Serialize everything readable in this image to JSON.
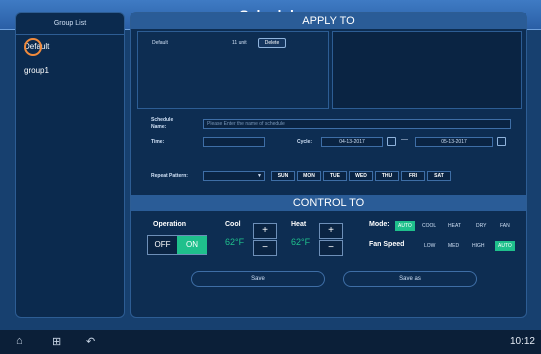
{
  "window": {
    "title": "Schedule"
  },
  "sidebar": {
    "header": "Group List",
    "groups": [
      {
        "label": "Default",
        "selected": true
      },
      {
        "label": "group1",
        "selected": false
      }
    ]
  },
  "apply_to": {
    "title": "APPLY TO",
    "entry": {
      "name": "Default",
      "units": "11 unit",
      "delete_label": "Delete"
    }
  },
  "schedule": {
    "name_label_1": "Schedule",
    "name_label_2": "Name:",
    "name_placeholder": "Please Enter the name of schedule",
    "time_label": "Time:",
    "cycle_label": "Cycle:",
    "cycle_start": "04-13-2017",
    "cycle_end": "05-13-2017",
    "repeat_label": "Repeat Pattern:",
    "days": [
      "SUN",
      "MON",
      "TUE",
      "WED",
      "THU",
      "FRI",
      "SAT"
    ]
  },
  "control_to": {
    "title": "CONTROL TO",
    "operation_label": "Operation",
    "off_label": "OFF",
    "on_label": "ON",
    "operation_state": "ON",
    "cool_label": "Cool",
    "cool_value": "62°F",
    "heat_label": "Heat",
    "heat_value": "62°F",
    "plus": "+",
    "minus": "−",
    "mode_label": "Mode:",
    "modes": [
      "AUTO",
      "COOL",
      "HEAT",
      "DRY",
      "FAN"
    ],
    "active_mode": "AUTO",
    "fan_label": "Fan Speed",
    "fan_speeds": [
      "LOW",
      "MED",
      "HIGH",
      "AUTO"
    ],
    "active_fan": "AUTO"
  },
  "buttons": {
    "save": "Save",
    "save_as": "Save as"
  },
  "statusbar": {
    "clock": "10:12"
  },
  "colors": {
    "accent": "#1fc08c",
    "title_bar": "#3a73bd",
    "background": "#0f2f57",
    "highlight_ring": "#f08a3c"
  }
}
